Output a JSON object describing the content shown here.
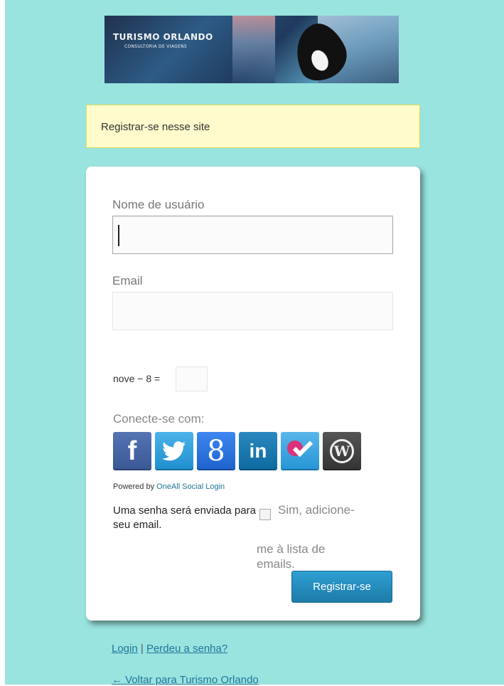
{
  "logo": {
    "title": "Turismo Orlando",
    "subtitle": "Consultoria de Viagens"
  },
  "message": "Registrar-se nesse site",
  "form": {
    "username_label": "Nome de usuário",
    "username_value": "",
    "email_label": "Email",
    "email_value": "",
    "captcha_question": "nove − 8 =",
    "captcha_value": "",
    "connect_label": "Conecte-se com:",
    "social": [
      {
        "name": "facebook-icon",
        "glyph": "f"
      },
      {
        "name": "twitter-icon",
        "glyph": "t"
      },
      {
        "name": "google-icon",
        "glyph": "8"
      },
      {
        "name": "linkedin-icon",
        "glyph": "in"
      },
      {
        "name": "foursquare-icon",
        "glyph": ""
      },
      {
        "name": "wordpress-icon",
        "glyph": "W"
      }
    ],
    "powered_prefix": "Powered by",
    "powered_link": "OneAll Social Login",
    "password_note": "Uma senha será enviada para seu email.",
    "newsletter_line1": "Sim, adicione-",
    "newsletter_line2": "me à lista de emails.",
    "newsletter_checked": false,
    "submit_label": "Registrar-se"
  },
  "nav": {
    "login": "Login",
    "separator": "|",
    "lost_password": "Perdeu a senha?",
    "back": "← Voltar para Turismo Orlando"
  },
  "colors": {
    "background": "#99e4df",
    "message_bg": "#fffbcc",
    "button": "#2e8ec0",
    "link": "#21759b"
  }
}
